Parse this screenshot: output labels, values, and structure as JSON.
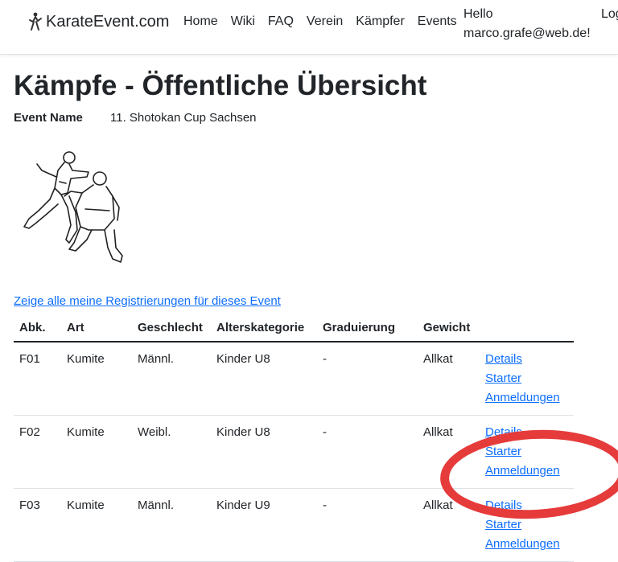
{
  "navbar": {
    "brand": "KarateEvent.com",
    "links": [
      "Home",
      "Wiki",
      "FAQ",
      "Verein",
      "Kämpfer",
      "Events"
    ],
    "hello_line1": "Hello",
    "hello_line2": "marco.grafe@web.de!",
    "logout_partial": "Log"
  },
  "page": {
    "title": "Kämpfe - Öffentliche Übersicht",
    "event_label": "Event Name",
    "event_value": "11. Shotokan Cup Sachsen",
    "registrations_link": "Zeige alle meine Registrierungen für dieses Event"
  },
  "table": {
    "headers": [
      "Abk.",
      "Art",
      "Geschlecht",
      "Alterskategorie",
      "Graduierung",
      "Gewicht",
      ""
    ],
    "action_labels": {
      "details": "Details",
      "starter": "Starter",
      "anmeldungen": "Anmeldungen"
    },
    "rows": [
      {
        "abk": "F01",
        "art": "Kumite",
        "geschlecht": "Männl.",
        "alterskategorie": "Kinder U8",
        "graduierung": "-",
        "gewicht": "Allkat"
      },
      {
        "abk": "F02",
        "art": "Kumite",
        "geschlecht": "Weibl.",
        "alterskategorie": "Kinder U8",
        "graduierung": "-",
        "gewicht": "Allkat"
      },
      {
        "abk": "F03",
        "art": "Kumite",
        "geschlecht": "Männl.",
        "alterskategorie": "Kinder U9",
        "graduierung": "-",
        "gewicht": "Allkat"
      }
    ]
  },
  "colors": {
    "link": "#0d6efd",
    "highlight_ring": "#e63b3b",
    "text": "#212529"
  }
}
